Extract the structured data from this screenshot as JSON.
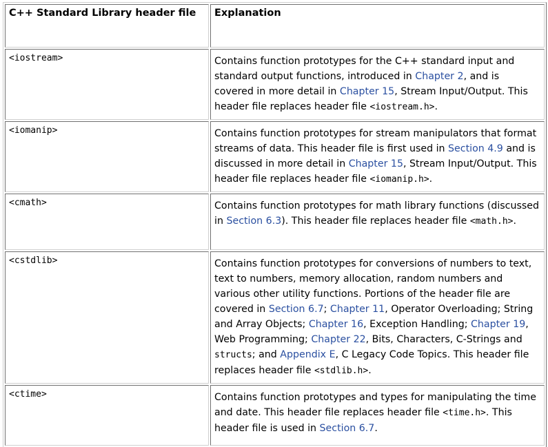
{
  "table": {
    "columns": [
      "C++ Standard Library header file",
      "Explanation"
    ],
    "rows": [
      {
        "header": "<iostream>",
        "explanation": [
          {
            "t": "Contains function prototypes for the C++ standard input and standard output functions, introduced in "
          },
          {
            "t": "Chapter 2",
            "link": true
          },
          {
            "t": ", and is covered in more detail in "
          },
          {
            "t": "Chapter 15",
            "link": true
          },
          {
            "t": ", Stream Input/Output. This header file replaces header file "
          },
          {
            "t": "<iostream.h>",
            "code": true
          },
          {
            "t": "."
          }
        ]
      },
      {
        "header": "<iomanip>",
        "explanation": [
          {
            "t": "Contains function prototypes for stream manipulators that format streams of data. This header file is first used in "
          },
          {
            "t": "Section 4.9",
            "link": true
          },
          {
            "t": " and is discussed in more detail in "
          },
          {
            "t": "Chapter 15",
            "link": true
          },
          {
            "t": ", Stream Input/Output. This header file replaces header file "
          },
          {
            "t": "<iomanip.h>",
            "code": true
          },
          {
            "t": "."
          }
        ]
      },
      {
        "header": "<cmath>",
        "explanation": [
          {
            "t": "Contains function prototypes for math library functions (discussed in "
          },
          {
            "t": "Section 6.3",
            "link": true
          },
          {
            "t": "). This header file replaces header file "
          },
          {
            "t": "<math.h>",
            "code": true
          },
          {
            "t": "."
          }
        ]
      },
      {
        "header": "<cstdlib>",
        "explanation": [
          {
            "t": "Contains function prototypes for conversions of numbers to text, text to numbers, memory allocation, random numbers and various other utility functions. Portions of the header file are covered in "
          },
          {
            "t": "Section 6.7",
            "link": true
          },
          {
            "t": "; "
          },
          {
            "t": "Chapter 11",
            "link": true
          },
          {
            "t": ", Operator Overloading; String and Array Objects; "
          },
          {
            "t": "Chapter 16",
            "link": true
          },
          {
            "t": ", Exception Handling; "
          },
          {
            "t": "Chapter 19",
            "link": true
          },
          {
            "t": ", Web Programming; "
          },
          {
            "t": "Chapter 22",
            "link": true
          },
          {
            "t": ", Bits, Characters, C-Strings and "
          },
          {
            "t": "structs",
            "code": true
          },
          {
            "t": "; and "
          },
          {
            "t": "Appendix E",
            "link": true
          },
          {
            "t": ", C Legacy Code Topics. This header file replaces header file "
          },
          {
            "t": "<stdlib.h>",
            "code": true
          },
          {
            "t": "."
          }
        ]
      },
      {
        "header": "<ctime>",
        "explanation": [
          {
            "t": "Contains function prototypes and types for manipulating the time and date. This header file replaces header file "
          },
          {
            "t": "<time.h>",
            "code": true
          },
          {
            "t": ". This header file is used in "
          },
          {
            "t": "Section 6.7",
            "link": true
          },
          {
            "t": "."
          }
        ]
      }
    ]
  }
}
